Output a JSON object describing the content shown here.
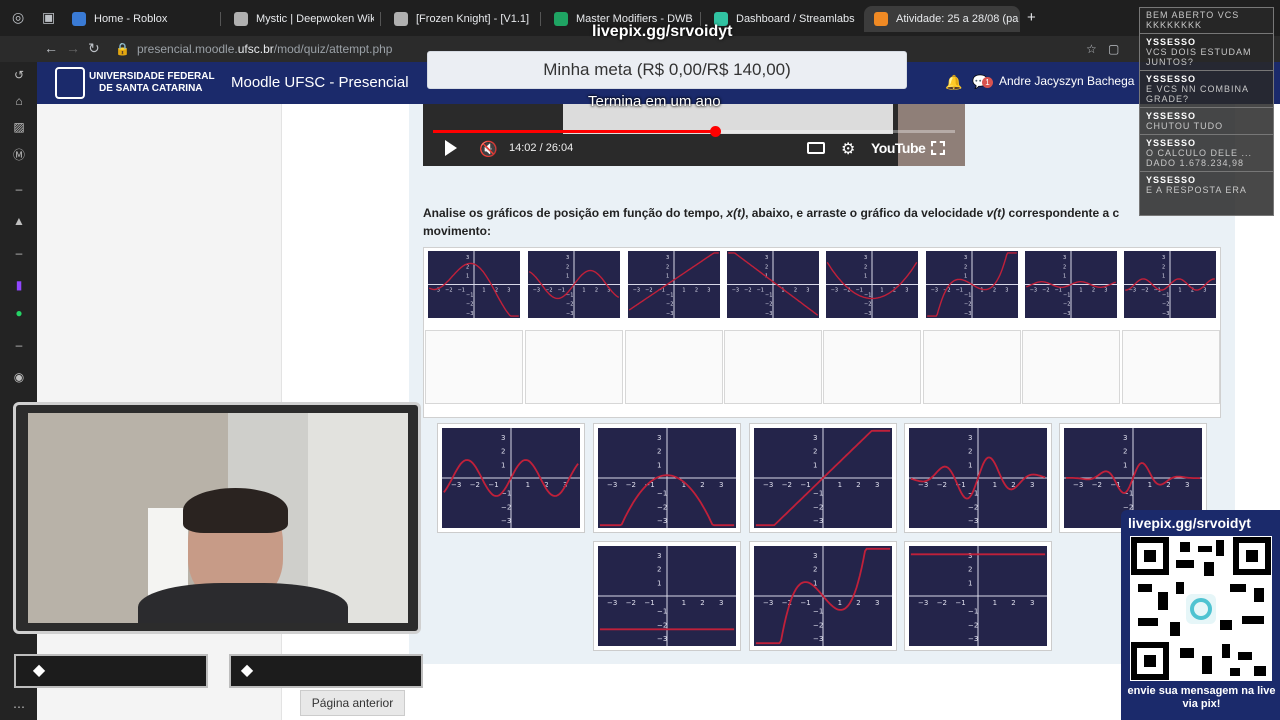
{
  "browser": {
    "tabs": [
      {
        "title": "Home - Roblox",
        "active": false,
        "color": "#3a7bd5"
      },
      {
        "title": "Mystic | Deepwoken Wiki",
        "active": false,
        "color": "#b0b0b0"
      },
      {
        "title": "[Frozen Knight] - [V1.1]",
        "active": false,
        "color": "#b0b0b0"
      },
      {
        "title": "Master Modifiers - DWB",
        "active": false,
        "color": "#1fa463"
      },
      {
        "title": "Dashboard / Streamlabs",
        "active": false,
        "color": "#31c3a2"
      },
      {
        "title": "Atividade: 25 a 28/08 (pa",
        "active": true,
        "color": "#f08a24"
      }
    ],
    "new_tab": "+",
    "url_prefix": "presencial.moodle.",
    "url_domain": "ufsc.br",
    "url_path": "/mod/quiz/attempt.php"
  },
  "moodle": {
    "university_line1": "UNIVERSIDADE FEDERAL",
    "university_line2": "DE SANTA CATARINA",
    "site_name": "Moodle UFSC - Presencial",
    "messages_count": "1",
    "user_name": "Andre Jacyszyn Bachega",
    "video_time": "14:02 / 26:04",
    "video_progress": 0.54,
    "youtube_label": "YouTube",
    "question_prefix": "Analise os gráficos de posição em função do tempo, ",
    "question_xt": "x(t)",
    "question_middle": ", abaixo, e arraste o gráfico da velocidade ",
    "question_vt": "v(t)",
    "question_suffix": " correspondente a c",
    "question_line2": "movimento:",
    "prev_page": "Página anterior"
  },
  "graphs": {
    "tick_labels_x": [
      "−3",
      "−2",
      "−1",
      "1",
      "2",
      "3"
    ],
    "tick_labels_y": [
      "3",
      "2",
      "1",
      "−1",
      "−2",
      "−3"
    ],
    "line_color": "#c0203a",
    "bg_color": "#24244a"
  },
  "stream": {
    "livepix_url": "livepix.gg/srvoidyt",
    "goal": "Minha meta (R$ 0,00/R$ 140,00)",
    "goal_status": "Termina em um ano",
    "qr_title": "livepix.gg/srvoidyt",
    "qr_message": "envie sua mensagem na live via pix!",
    "chat": [
      {
        "user": "",
        "text": "BEM ABERTO VCS"
      },
      {
        "user": "",
        "text": "KKKKKKKK"
      },
      {
        "user": "YSSESSO",
        "text": "VCS DOIS ESTUDAM JUNTOS?"
      },
      {
        "user": "YSSESSO",
        "text": "E VCS NN COMBINA GRADE?"
      },
      {
        "user": "YSSESSO",
        "text": "CHUTOU TUDO"
      },
      {
        "user": "YSSESSO",
        "text": "O CALCULO DELE ... DADO 1.678.234,98"
      },
      {
        "user": "YSSESSO",
        "text": "E A RESPOSTA ERA"
      }
    ]
  }
}
